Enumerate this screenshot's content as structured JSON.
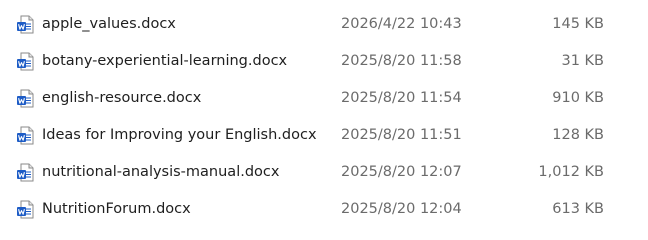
{
  "files": [
    {
      "name": "apple_values.docx",
      "modified": "2026/4/22 10:43",
      "size": "145 KB",
      "icon": "word-document-icon"
    },
    {
      "name": "botany-experiential-learning.docx",
      "modified": "2025/8/20 11:58",
      "size": "31 KB",
      "icon": "word-document-icon"
    },
    {
      "name": "english-resource.docx",
      "modified": "2025/8/20 11:54",
      "size": "910 KB",
      "icon": "word-document-icon"
    },
    {
      "name": "Ideas for Improving your English.docx",
      "modified": "2025/8/20 11:51",
      "size": "128 KB",
      "icon": "word-document-icon"
    },
    {
      "name": "nutritional-analysis-manual.docx",
      "modified": "2025/8/20 12:07",
      "size": "1,012 KB",
      "icon": "word-document-icon"
    },
    {
      "name": "NutritionForum.docx",
      "modified": "2025/8/20 12:04",
      "size": "613 KB",
      "icon": "word-document-icon"
    }
  ],
  "colors": {
    "word_blue": "#1d5cc6",
    "word_blue_dark": "#134aa6",
    "page_white": "#ffffff",
    "meta_text": "#6b6b6b"
  }
}
